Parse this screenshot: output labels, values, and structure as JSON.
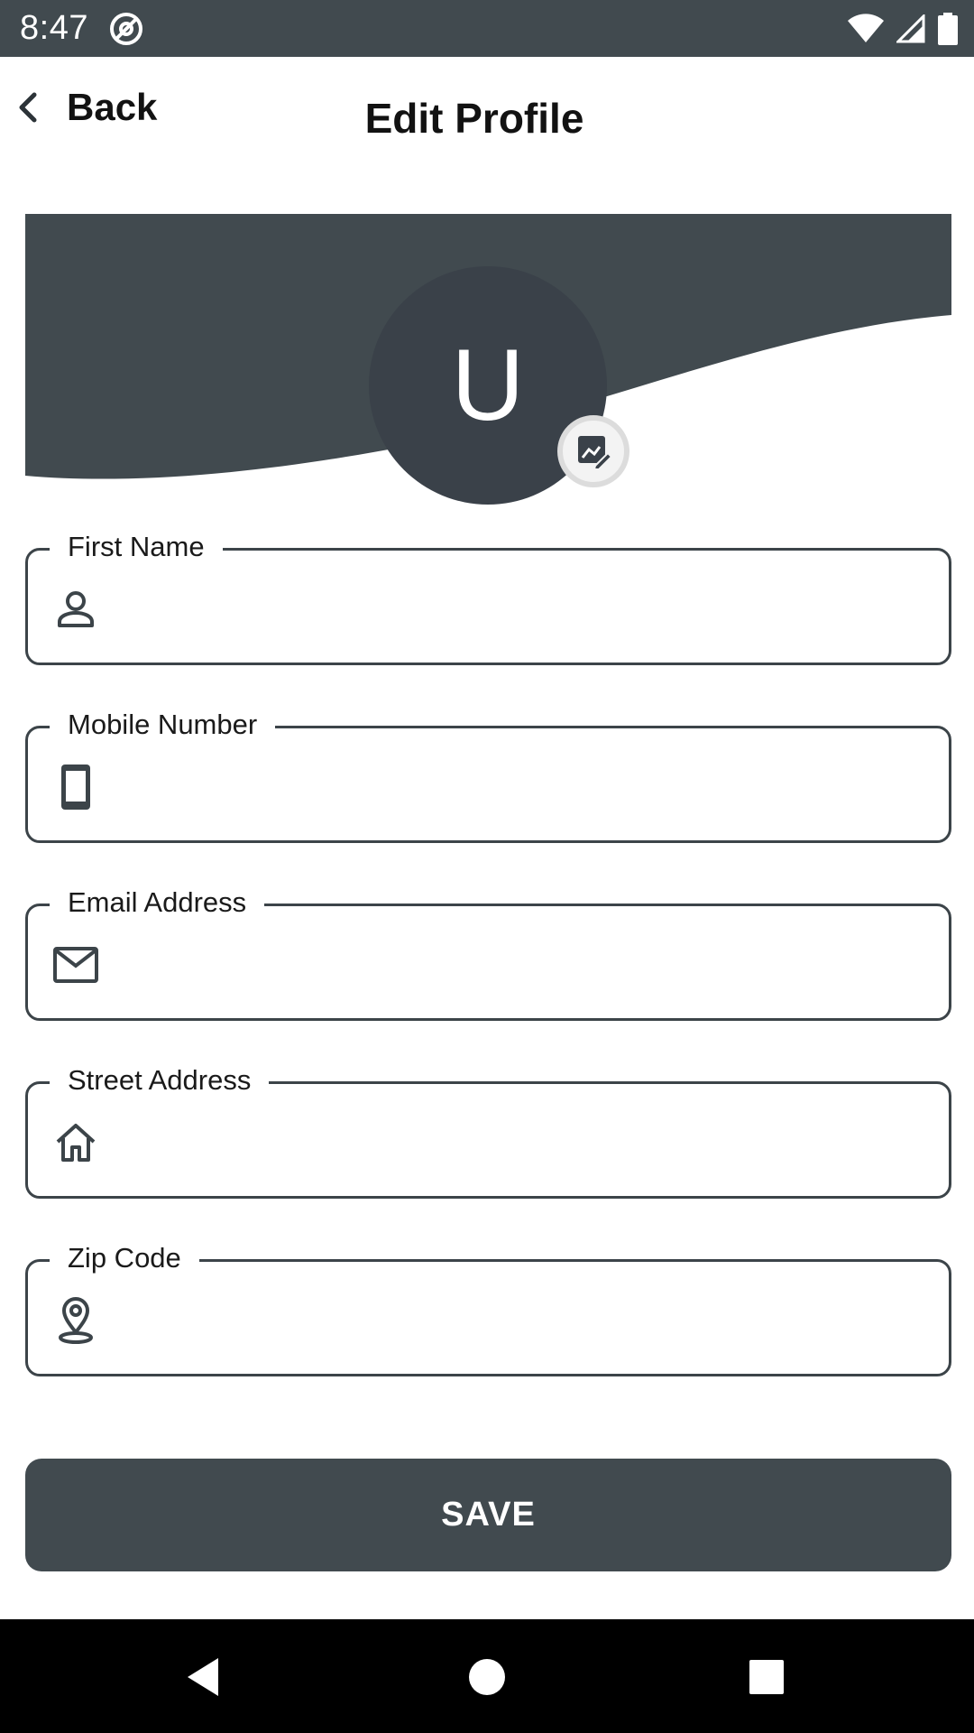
{
  "status_bar": {
    "time": "8:47",
    "icons": [
      "at-sign-icon",
      "wifi-icon",
      "signal-icon",
      "battery-icon"
    ]
  },
  "app_bar": {
    "back_label": "Back",
    "title": "Edit Profile"
  },
  "profile": {
    "avatar_initial": "U",
    "edit_photo_icon": "image-edit-icon"
  },
  "form": {
    "fields": [
      {
        "label": "First Name",
        "value": "",
        "icon": "person-icon"
      },
      {
        "label": "Mobile Number",
        "value": "",
        "icon": "phone-icon"
      },
      {
        "label": "Email Address",
        "value": "",
        "icon": "mail-icon"
      },
      {
        "label": "Street Address",
        "value": "",
        "icon": "home-icon"
      },
      {
        "label": "Zip Code",
        "value": "",
        "icon": "location-pin-icon"
      }
    ],
    "save_label": "SAVE"
  },
  "nav_bar": {
    "buttons": [
      "back-triangle-icon",
      "home-circle-icon",
      "recents-square-icon"
    ]
  },
  "colors": {
    "primary": "#414a4f",
    "avatar": "#3a4149",
    "field_border": "#3c4449",
    "nav_background": "#000000"
  }
}
